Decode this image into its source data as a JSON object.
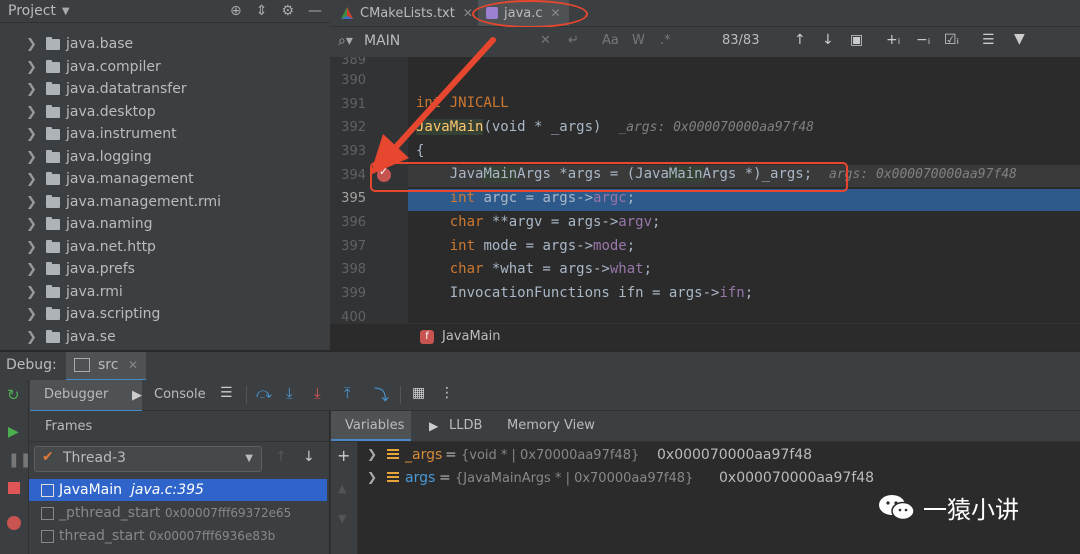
{
  "project": {
    "title": "Project",
    "items": [
      "java.base",
      "java.compiler",
      "java.datatransfer",
      "java.desktop",
      "java.instrument",
      "java.logging",
      "java.management",
      "java.management.rmi",
      "java.naming",
      "java.net.http",
      "java.prefs",
      "java.rmi",
      "java.scripting",
      "java.se"
    ]
  },
  "tabs": [
    {
      "label": "CMakeLists.txt"
    },
    {
      "label": "java.c"
    }
  ],
  "search": {
    "query": "MAIN",
    "count": "83/83"
  },
  "editor": {
    "lines": [
      {
        "num": "389"
      },
      {
        "num": "390"
      },
      {
        "num": "391",
        "t1": "int ",
        "t2": "JNICALL"
      },
      {
        "num": "392",
        "fn": "JavaMain",
        "rest": "(void * _args)",
        "hint": "_args: 0x000070000aa97f48"
      },
      {
        "num": "393",
        "text": "{"
      },
      {
        "num": "394",
        "a": "    Java",
        "b": "Main",
        "c": "Args *args = (Java",
        "d": "Main",
        "e": "Args *)_args;",
        "hint": "args: 0x000070000aa97f48"
      },
      {
        "num": "395",
        "kw": "    int ",
        "a": "argc = args->",
        "fld": "argc",
        ";": ";"
      },
      {
        "num": "396",
        "kw": "    char ",
        "a": "**argv = args->",
        "fld": "argv",
        ";": ";"
      },
      {
        "num": "397",
        "kw": "    int ",
        "a": "mode = args->",
        "fld": "mode",
        ";": ";"
      },
      {
        "num": "398",
        "kw": "    char ",
        "a": "*what = args->",
        "fld": "what",
        ";": ";"
      },
      {
        "num": "399",
        "a": "    InvocationFunctions ifn = args->",
        "fld": "ifn",
        ";": ";"
      },
      {
        "num": "400"
      }
    ],
    "footer_function": "JavaMain"
  },
  "debug": {
    "label": "Debug:",
    "session": "src",
    "tabs": {
      "debugger": "Debugger",
      "console": "Console"
    },
    "frames_label": "Frames",
    "thread": "Thread-3",
    "frames": [
      {
        "name": "JavaMain",
        "loc": "java.c:395"
      },
      {
        "name": "_pthread_start",
        "loc": "0x00007fff69372e65"
      },
      {
        "name": "thread_start",
        "loc": "0x00007fff6936e83b"
      }
    ],
    "var_tabs": {
      "variables": "Variables",
      "lldb": "LLDB",
      "memory": "Memory View"
    },
    "variables": [
      {
        "name": "_args",
        "type": "{void * | 0x70000aa97f48}",
        "value": "0x000070000aa97f48"
      },
      {
        "name": "args",
        "type": "{JavaMainArgs * | 0x70000aa97f48}",
        "value": "0x000070000aa97f48"
      }
    ]
  },
  "watermark": "一猿小讲",
  "colors": {
    "annotation": "#e8472f",
    "selection": "#2f65ca",
    "current_line": "#2d5a8a"
  }
}
